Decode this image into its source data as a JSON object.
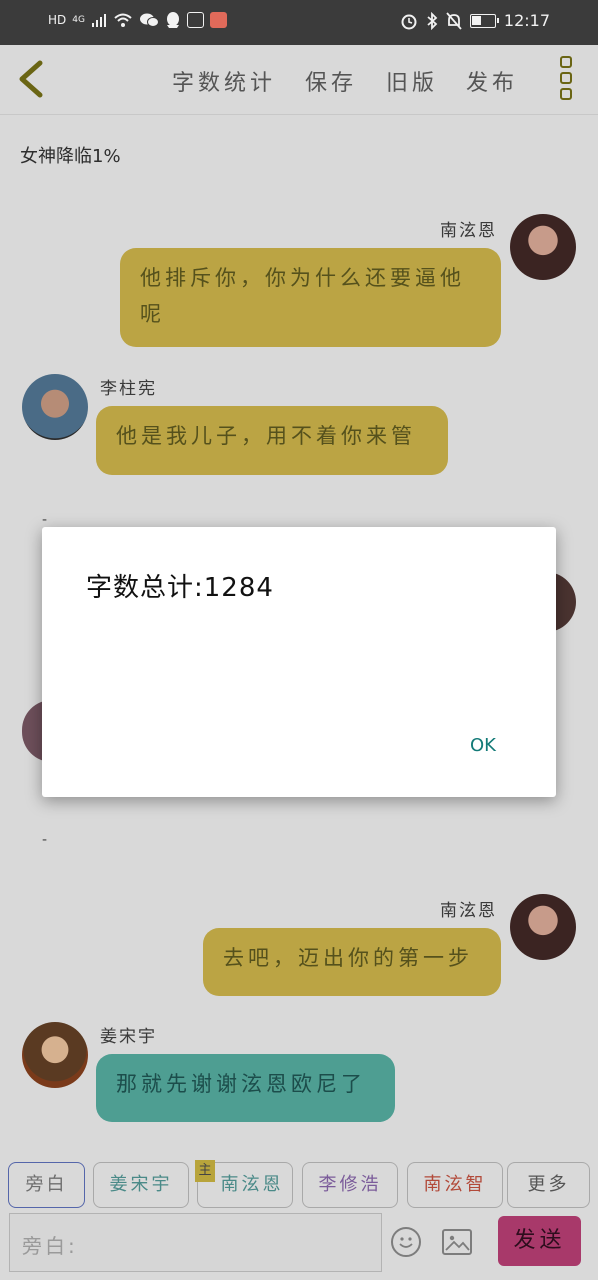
{
  "status_bar": {
    "left_icons": [
      "HD",
      "4G",
      "signal-icon",
      "wifi-icon",
      "wechat-icon",
      "qq-icon",
      "app-icon",
      "app-icon-2"
    ],
    "time": "12:17",
    "hd": "HD",
    "network": "4G"
  },
  "toolbar": {
    "word_count": "字数统计",
    "save": "保存",
    "old_version": "旧版",
    "publish": "发布"
  },
  "chat": {
    "narration": "女神降临1%",
    "messages": [
      {
        "name": "南泫恩",
        "text_line1": "他排斥你，你为什么还要逼他",
        "text_line2": "呢",
        "side": "right"
      },
      {
        "name": "李柱宪",
        "text": "他是我儿子，用不着你来管",
        "side": "left"
      },
      {
        "name": "南泫恩",
        "text": "去吧，迈出你的第一步",
        "side": "right"
      },
      {
        "name": "姜宋宇",
        "text": "那就先谢谢泫恩欧尼了",
        "side": "left"
      }
    ],
    "dash": "-"
  },
  "dialog": {
    "message": "字数总计:1284",
    "ok": "OK"
  },
  "tabs": {
    "narration": "旁白",
    "jiang": "姜宋宇",
    "main_tag": "主",
    "nan": "南泫恩",
    "li": "李修浩",
    "nan2": "南泫智",
    "more": "更多"
  },
  "input": {
    "placeholder": "旁白:",
    "send": "发送"
  },
  "colors": {
    "bubble_yellow": "#bba444",
    "bubble_teal": "#4e9e92",
    "send_button": "#a8396a",
    "ok_text": "#137a77"
  }
}
